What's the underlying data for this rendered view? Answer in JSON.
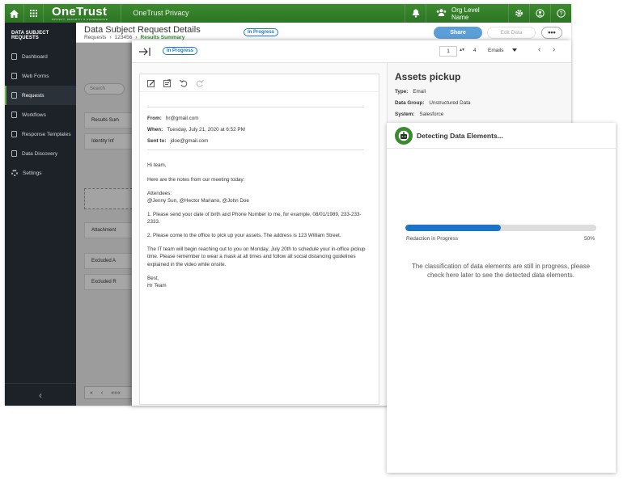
{
  "topbar": {
    "logo": "OneTrust",
    "logo_tagline": "PRIVACY, SECURITY & GOVERNANCE",
    "product": "OneTrust Privacy",
    "org_label": "Org Level Name",
    "icons": [
      "home-icon",
      "apps-grid-icon",
      "notification-bell-icon",
      "org-people-icon",
      "gear-icon",
      "user-icon",
      "help-icon"
    ]
  },
  "sidebar": {
    "title": "DATA SUBJECT REQUESTS",
    "items": [
      {
        "label": "Dashboard",
        "icon": "dashboard-icon"
      },
      {
        "label": "Web Forms",
        "icon": "web-forms-icon"
      },
      {
        "label": "Requests",
        "icon": "requests-icon"
      },
      {
        "label": "Workflows",
        "icon": "workflows-icon"
      },
      {
        "label": "Response Templates",
        "icon": "response-templates-icon"
      },
      {
        "label": "Data Discovery",
        "icon": "data-discovery-icon"
      },
      {
        "label": "Settings",
        "icon": "gear-icon"
      }
    ],
    "active_index": 2,
    "collapse_glyph": "‹"
  },
  "header": {
    "title": "Data Subject Request Details",
    "breadcrumb": [
      "Requests",
      "123456",
      "Results Summary"
    ],
    "status": "In Progress",
    "share_label": "Share",
    "edit_label": "Edit Data",
    "more_label": "•••"
  },
  "underlying": {
    "search_placeholder": "Search",
    "rows": [
      "Results Sum",
      "Identity Inf",
      "Attachment",
      "Excluded A",
      "Excluded R"
    ],
    "pager": [
      "«",
      "‹",
      "«««"
    ]
  },
  "drawer": {
    "status": "In Progress",
    "page_current": "1",
    "page_total": "4",
    "doc_type": "Emails",
    "email": {
      "from_label": "From:",
      "from": "hr@gmail.com",
      "when_label": "When:",
      "when": "Tuesday, July 21, 2020 at 6:52 PM",
      "to_label": "Sent to:",
      "to": "jdoe@gmail.com",
      "greeting": "Hi team,",
      "intro": "Here are the notes from our meeting today:",
      "attendees_label": "Attendees:",
      "attendees": "@Jenny Sun, @Hector Mariano, @John Doe",
      "item1": "1. Please send your date of birth and Phone Number to me, for example, 08/01/1989, 233-233-2333.",
      "item2": "2. Please come to the office to pick up your assets. The address is 123 William Street.",
      "item3": "The IT team will begin reaching out to you on Monday, July 20th to schedule your in-office pickup time. Please remember to wear a mask at all times and follow all social distancing guidelines explained in the video while onsite.",
      "signoff": "Best,",
      "signature": "Hr Team"
    },
    "assets": {
      "title": "Assets pickup",
      "type_label": "Type:",
      "type": "Email",
      "group_label": "Data Group:",
      "group": "Unstructured Data",
      "system_label": "System:",
      "system": "Salesforce"
    }
  },
  "detect": {
    "title": "Detecting Data Elements...",
    "progress_label": "Redaction in Progress",
    "progress_text": "50%",
    "progress_value": 0.5,
    "message": "The classification of data elements are still in progress, please check here later to see the detected data elements."
  },
  "colors": {
    "brand_green": "#2c7424",
    "accent_blue": "#1a75c9",
    "sidebar_bg": "#1d2228"
  }
}
